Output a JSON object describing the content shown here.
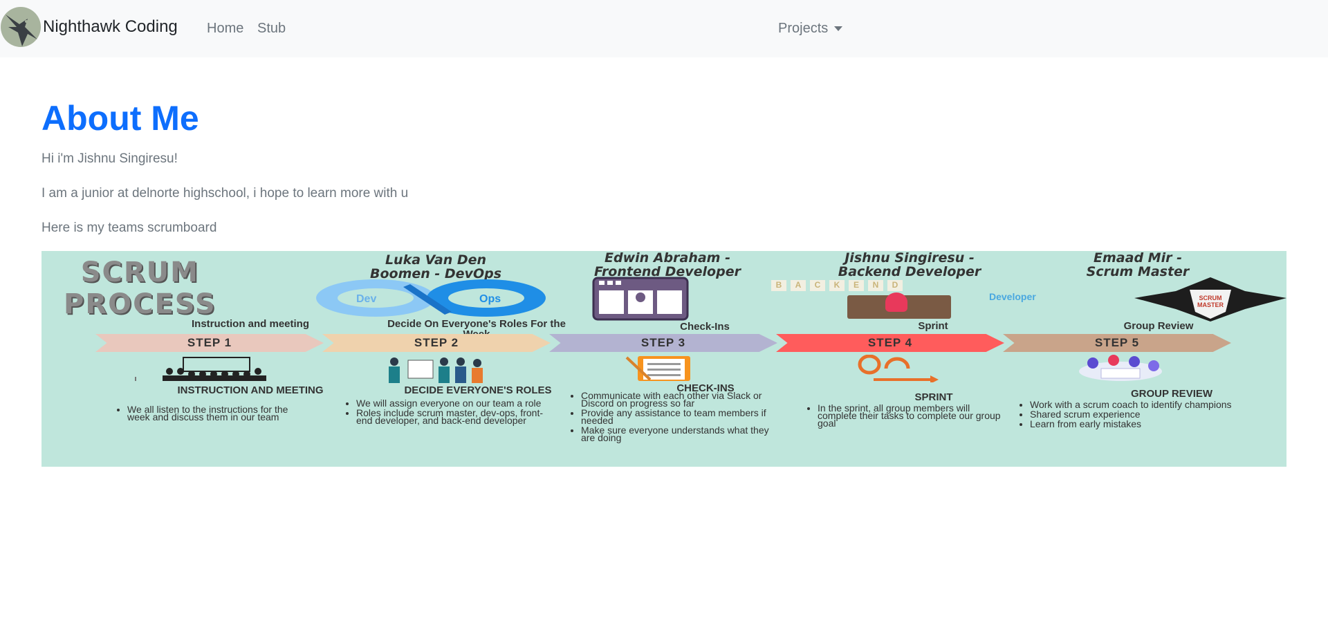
{
  "navbar": {
    "brand": "Nighthawk Coding",
    "links": [
      "Home",
      "Stub"
    ],
    "dropdown_label": "Projects",
    "background": "#f8f9fa"
  },
  "main": {
    "title": "About Me",
    "title_color": "#0d6efd",
    "paragraphs": [
      "Hi i'm Jishnu Singiresu!",
      "I am a junior at delnorte highschool, i hope to learn more with u",
      "Here is my teams scrumboard"
    ]
  },
  "scrumboard": {
    "title_line1": "SCRUM",
    "title_line2": "PROCESS",
    "background": "#bfe6dc",
    "people": [
      {
        "line1": "Luka Van Den",
        "line2": "Boomen - DevOps"
      },
      {
        "line1": "Edwin Abraham -",
        "line2": "Frontend Developer"
      },
      {
        "line1": "Jishnu Singiresu -",
        "line2": "Backend Developer"
      },
      {
        "line1": "Emaad Mir -",
        "line2": "Scrum Master"
      }
    ],
    "steps": [
      {
        "head": "Instruction and meeting",
        "label": "STEP 1",
        "color": "#e9c8bd",
        "title": "INSTRUCTION AND MEETING",
        "bullets": [
          "We all listen to the instructions for the week and discuss them in our team"
        ]
      },
      {
        "head": "Decide On Everyone's Roles For the Week",
        "label": "STEP 2",
        "color": "#efd2ad",
        "title": "DECIDE EVERYONE'S ROLES",
        "bullets": [
          "We will assign everyone on our team a role",
          "Roles include scrum master, dev-ops, front-end developer, and back-end developer"
        ]
      },
      {
        "head": "Check-Ins",
        "label": "STEP 3",
        "color": "#b3b3d1",
        "title": "CHECK-INS",
        "bullets": [
          "Communicate with each other via Slack or Discord on progress so far",
          "Provide any assistance to team members if needed",
          "Make sure everyone understands what they are doing"
        ]
      },
      {
        "head": "Sprint",
        "label": "STEP 4",
        "color": "#ff5c5c",
        "title": "SPRINT",
        "bullets": [
          "In the sprint, all group members will complete their tasks to complete our group goal"
        ]
      },
      {
        "head": "Group Review",
        "label": "STEP 5",
        "color": "#c9a48a",
        "title": "GROUP REVIEW",
        "bullets": [
          "Work with a scrum coach to identify champions",
          "Shared scrum experience",
          "Learn from early mistakes"
        ]
      }
    ],
    "devops_labels": [
      "Dev",
      "Ops"
    ],
    "backend_letters": [
      "B",
      "A",
      "C",
      "K",
      "E",
      "N",
      "D"
    ],
    "backend_sub": "Developer",
    "badge_text": [
      "SCRUM",
      "MASTER"
    ]
  }
}
